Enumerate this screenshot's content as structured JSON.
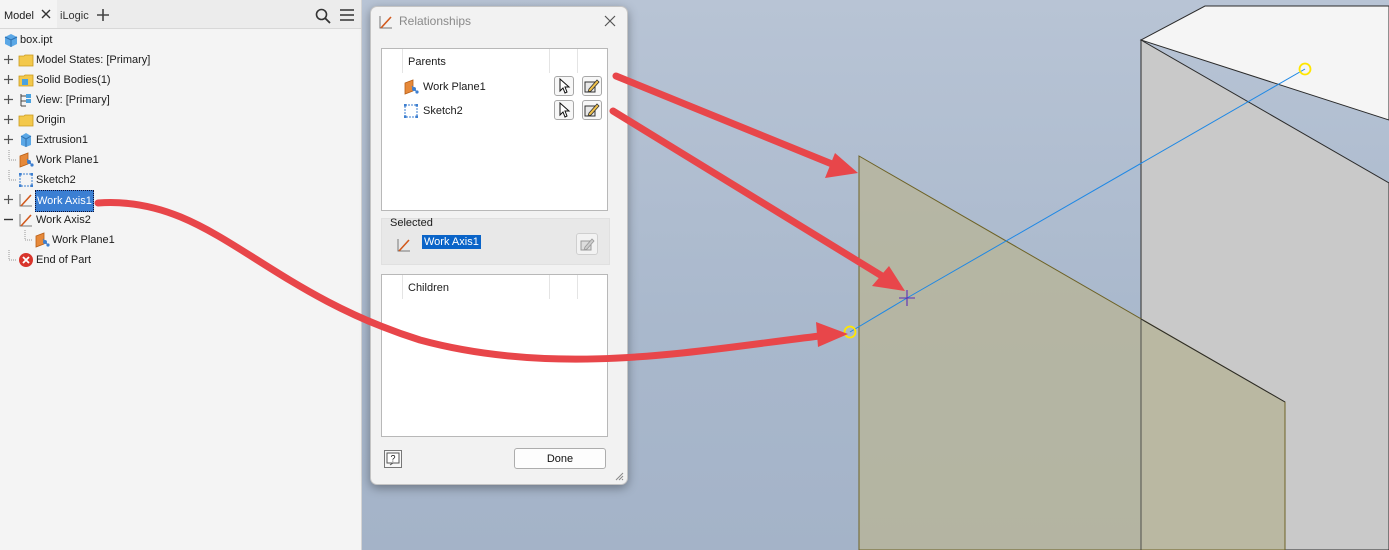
{
  "browser": {
    "tabs": [
      {
        "label": "Model",
        "active": true
      },
      {
        "label": "iLogic",
        "active": false
      }
    ],
    "tree": [
      {
        "label": "box.ipt",
        "icon": "part-icon",
        "expander": "none",
        "indent": 0
      },
      {
        "label": "Model States: [Primary]",
        "icon": "folder-icon",
        "expander": "plus",
        "indent": 1
      },
      {
        "label": "Solid Bodies(1)",
        "icon": "solid-bodies-folder-icon",
        "expander": "plus",
        "indent": 1
      },
      {
        "label": "View: [Primary]",
        "icon": "view-icon",
        "expander": "plus",
        "indent": 1
      },
      {
        "label": "Origin",
        "icon": "folder-icon",
        "expander": "plus",
        "indent": 1
      },
      {
        "label": "Extrusion1",
        "icon": "extrusion-icon",
        "expander": "plus",
        "indent": 1
      },
      {
        "label": "Work Plane1",
        "icon": "work-plane-icon",
        "expander": "none",
        "indent": 1
      },
      {
        "label": "Sketch2",
        "icon": "sketch-icon",
        "expander": "none",
        "indent": 1
      },
      {
        "label": "Work Axis1",
        "icon": "work-axis-icon",
        "expander": "plus",
        "indent": 1,
        "selected": true
      },
      {
        "label": "Work Axis2",
        "icon": "work-axis-icon",
        "expander": "minus",
        "indent": 1
      },
      {
        "label": "Work Plane1",
        "icon": "work-plane-icon",
        "expander": "none",
        "indent": 2
      },
      {
        "label": "End of Part",
        "icon": "end-of-part-icon",
        "expander": "none",
        "indent": 1
      }
    ]
  },
  "dialog": {
    "title": "Relationships",
    "parents_header": "Parents",
    "parents": [
      {
        "label": "Work Plane1",
        "icon": "work-plane-icon"
      },
      {
        "label": "Sketch2",
        "icon": "sketch-icon"
      }
    ],
    "selected_label": "Selected",
    "selected_value": "Work Axis1",
    "children_header": "Children",
    "children": [],
    "done_label": "Done",
    "help_label": "?"
  },
  "colors": {
    "annotation_arrow": "#e8464a",
    "selection": "#0a64c8",
    "work_plane_fill": "#b7b59a",
    "work_axis": "#1e88e5",
    "viewport_bg": "#aebcd0"
  }
}
